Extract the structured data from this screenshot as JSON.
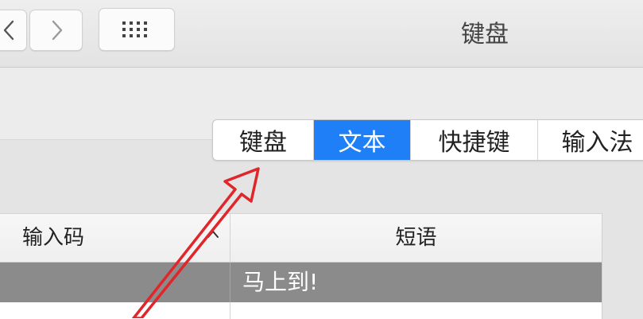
{
  "window": {
    "title": "键盘"
  },
  "toolbar": {
    "back_icon": "chevron-left-icon",
    "forward_icon": "chevron-right-icon",
    "grid_icon": "grid-icon"
  },
  "tabs": [
    {
      "label": "键盘",
      "active": false
    },
    {
      "label": "文本",
      "active": true
    },
    {
      "label": "快捷键",
      "active": false
    },
    {
      "label": "输入法",
      "active": false
    }
  ],
  "table": {
    "columns": [
      "输入码",
      "短语"
    ],
    "sort_icon": "chevron-up-icon",
    "rows": [
      {
        "code": "",
        "phrase": "马上到!",
        "selected": true
      }
    ]
  },
  "colors": {
    "accent": "#1f7ff6",
    "selected_row": "#8b8b8b",
    "annotation": "#e0262b"
  }
}
